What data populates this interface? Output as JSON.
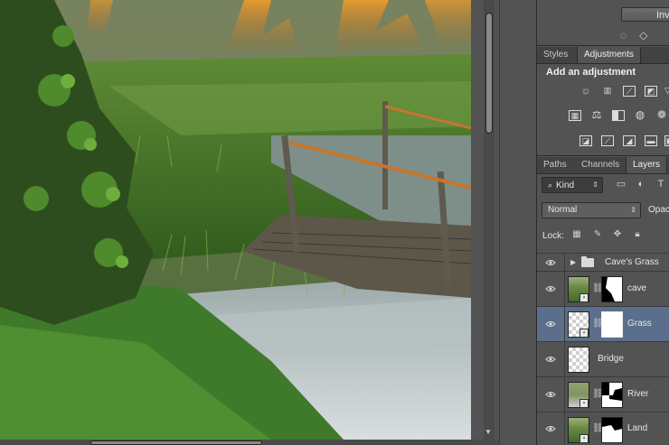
{
  "canvas": {
    "description_icon": "scene-image"
  },
  "toolbar_top": {
    "invert_label": "Invert"
  },
  "adjustments_panel": {
    "tabs": [
      {
        "label": "Styles",
        "active": false
      },
      {
        "label": "Adjustments",
        "active": true
      }
    ],
    "title": "Add an adjustment"
  },
  "layers_panel": {
    "tabs": [
      {
        "label": "Paths",
        "active": false
      },
      {
        "label": "Channels",
        "active": false
      },
      {
        "label": "Layers",
        "active": true
      }
    ],
    "filter_kind": "Kind",
    "blend_mode": "Normal",
    "opacity_label": "Opac",
    "lock_label": "Lock:",
    "layers": [
      {
        "name": "Cave's Grass",
        "type": "group"
      },
      {
        "name": "cave",
        "type": "layer",
        "selected": false
      },
      {
        "name": "Grass",
        "type": "layer",
        "selected": true
      },
      {
        "name": "Bridge",
        "type": "layer",
        "selected": false
      },
      {
        "name": "River",
        "type": "layer",
        "selected": false
      },
      {
        "name": "Land",
        "type": "layer",
        "selected": false
      }
    ]
  },
  "colors": {
    "panel_bg": "#535353",
    "selected_layer": "#5b6e8b",
    "tab_bar": "#424242"
  }
}
